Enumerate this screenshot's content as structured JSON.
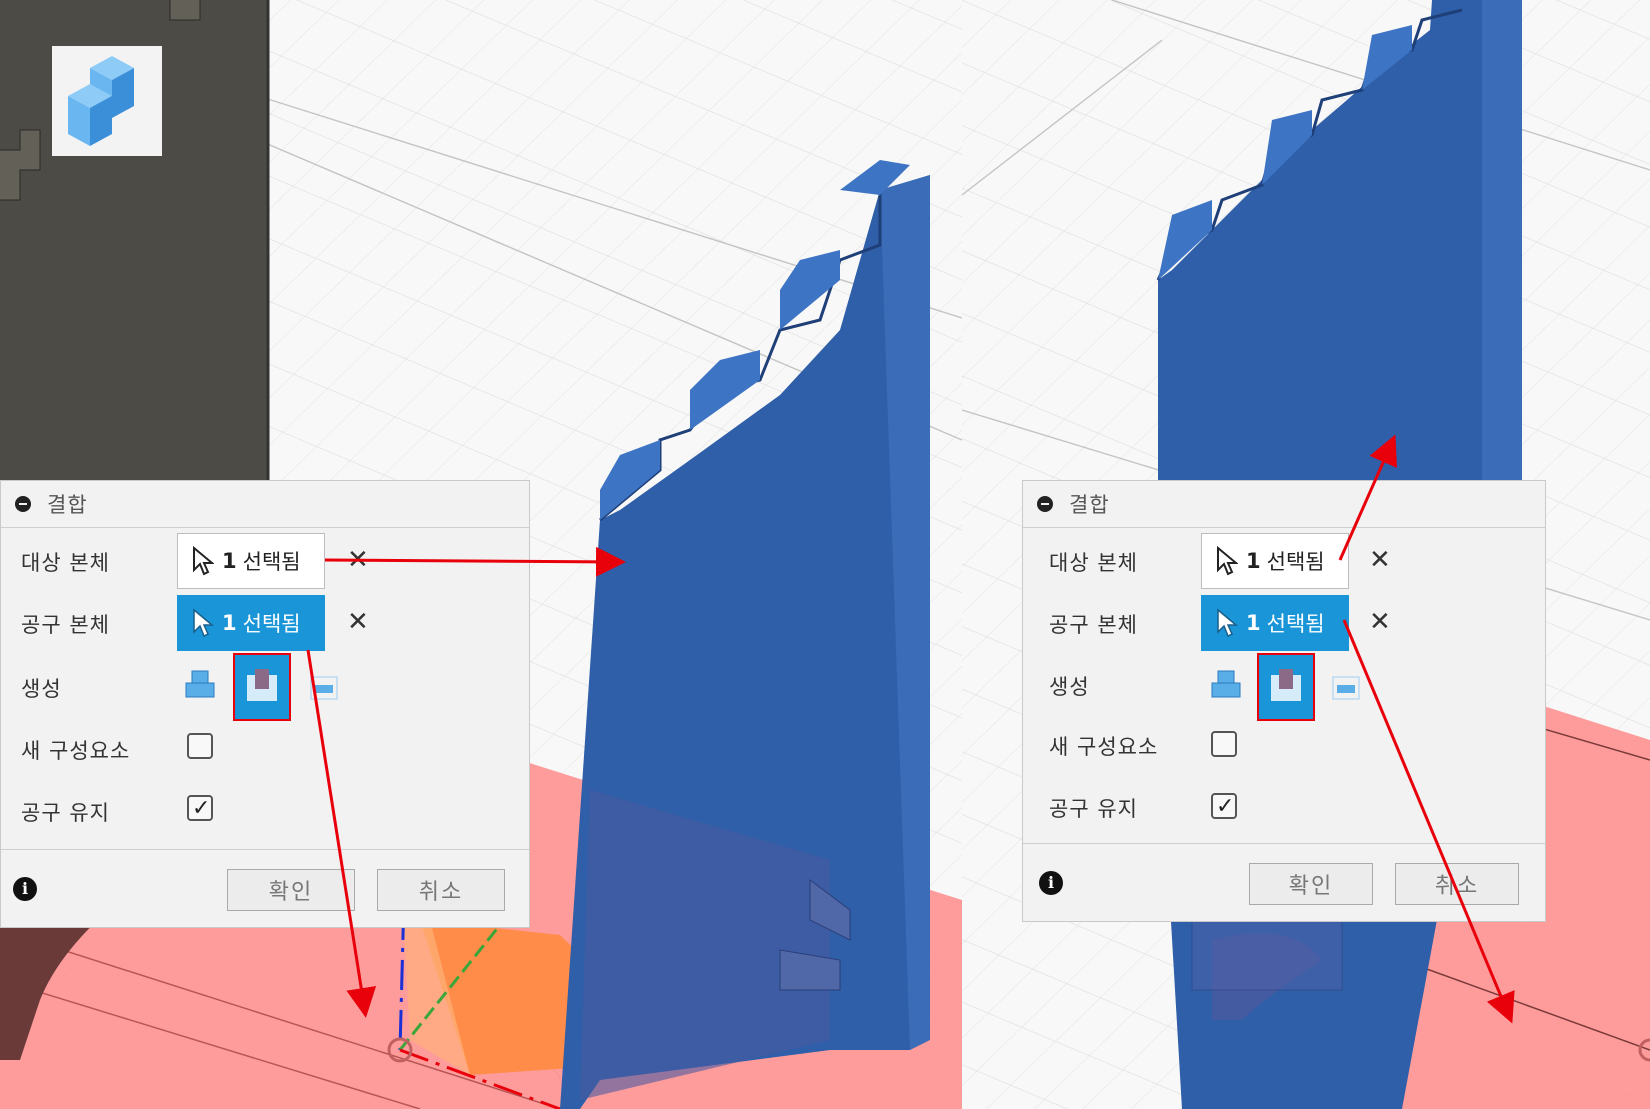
{
  "panels": [
    {
      "dialog_title": "결합",
      "target_label": "대상 본체",
      "target_count": "1",
      "target_text": "선택됨",
      "tool_label": "공구 본체",
      "tool_count": "1",
      "tool_text": "선택됨",
      "operation_label": "생성",
      "new_component_label": "새 구성요소",
      "new_component_checked": false,
      "keep_tools_label": "공구 유지",
      "keep_tools_checked": true,
      "ok_label": "확인",
      "cancel_label": "취소"
    },
    {
      "dialog_title": "결합",
      "target_label": "대상 본체",
      "target_count": "1",
      "target_text": "선택됨",
      "tool_label": "공구 본체",
      "tool_count": "1",
      "tool_text": "선택됨",
      "operation_label": "생성",
      "new_component_label": "새 구성요소",
      "new_component_checked": false,
      "keep_tools_label": "공구 유지",
      "keep_tools_checked": true,
      "ok_label": "확인",
      "cancel_label": "취소"
    }
  ],
  "icons": {
    "combine": "combine-icon",
    "collapse": "collapse-icon",
    "cursor": "cursor-arrow-icon",
    "clear": "close-icon",
    "join": "join-icon",
    "cut": "cut-icon",
    "intersect": "intersect-icon",
    "info": "info-icon",
    "checkbox_checked_glyph": "✓",
    "info_glyph": "i",
    "clear_glyph": "✕"
  },
  "colors": {
    "body_blue": "#2f5fa8",
    "body_gray": "#4d4b45",
    "plane_red": "#ff8c8c",
    "highlight_blue": "#1a96d8",
    "annotation_red": "#e8000b",
    "origin_axis_blue": "#1b2fd6",
    "origin_axis_green": "#3aa63a",
    "origin_plane_orange": "#ff8a3a"
  }
}
